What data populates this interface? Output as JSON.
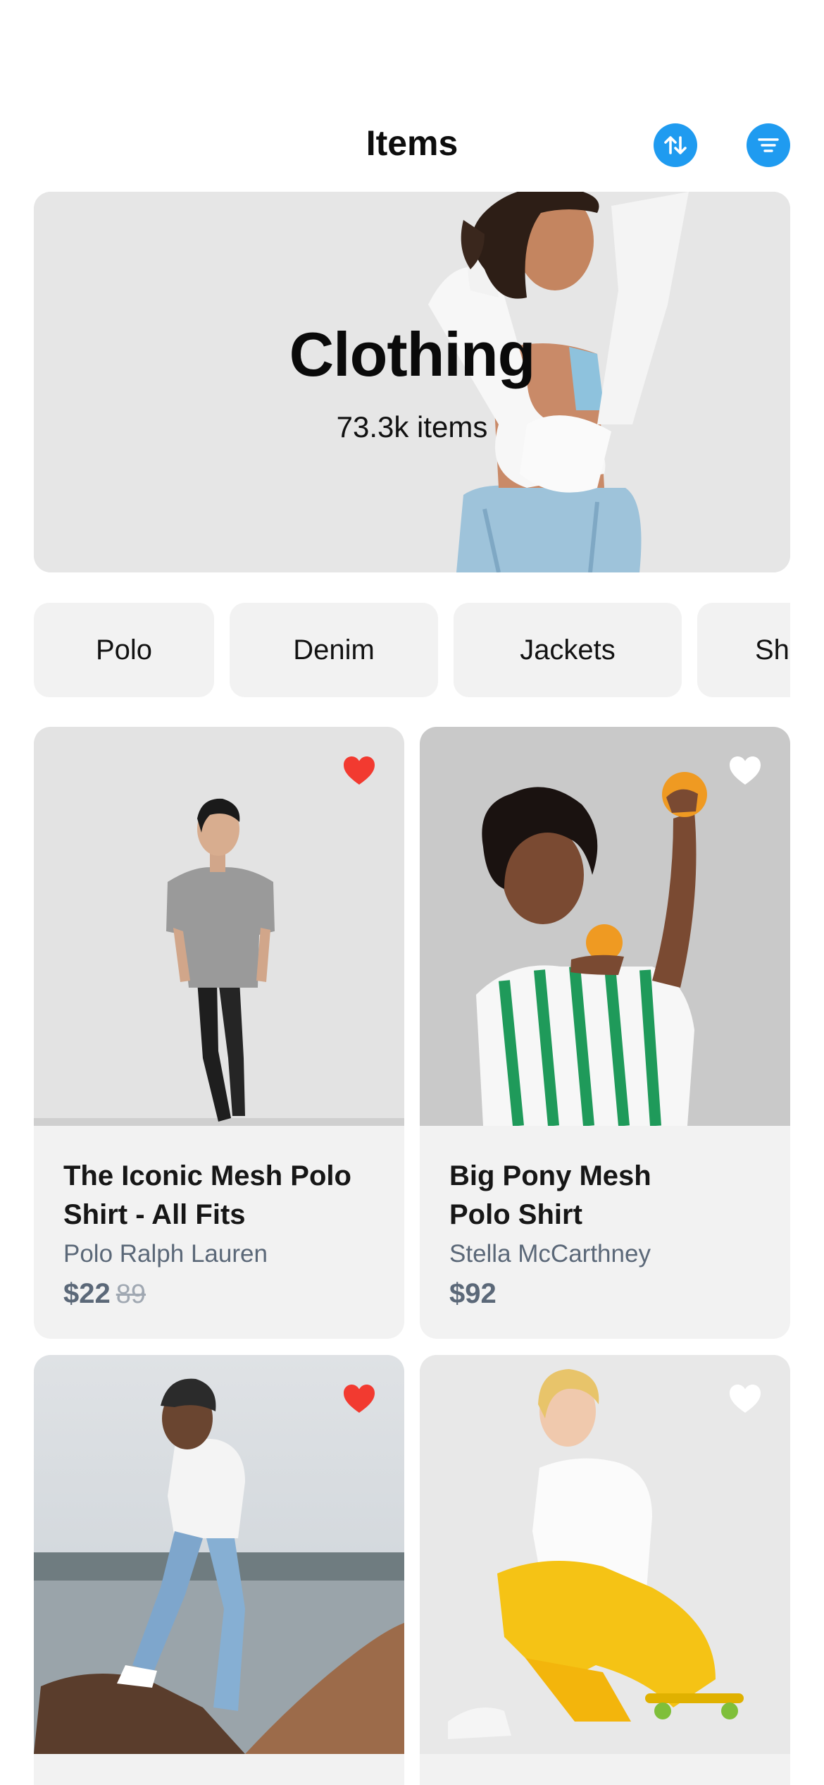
{
  "header": {
    "title": "Items",
    "sort_icon": "sort-arrows-icon",
    "filter_icon": "filter-lines-icon",
    "accent": "#1f9bf0"
  },
  "hero": {
    "title": "Clothing",
    "count": "73.3k items"
  },
  "categories": [
    {
      "label": "Polo"
    },
    {
      "label": "Denim"
    },
    {
      "label": "Jackets"
    },
    {
      "label": "Sh"
    }
  ],
  "products": [
    {
      "name_line1": "The Iconic Mesh Polo",
      "name_line2": "Shirt - All Fits",
      "brand": "Polo Ralph Lauren",
      "price": "$22",
      "old_price": "89",
      "favorite": true
    },
    {
      "name_line1": "Big Pony Mesh",
      "name_line2": "Polo Shirt",
      "brand": "Stella McCarthney",
      "price": "$92",
      "old_price": "",
      "favorite": false
    },
    {
      "favorite": true
    },
    {
      "favorite": false
    }
  ],
  "colors": {
    "favorite_active": "#f23a30",
    "favorite_inactive": "#ffffff",
    "muted_text": "#5b6878"
  }
}
